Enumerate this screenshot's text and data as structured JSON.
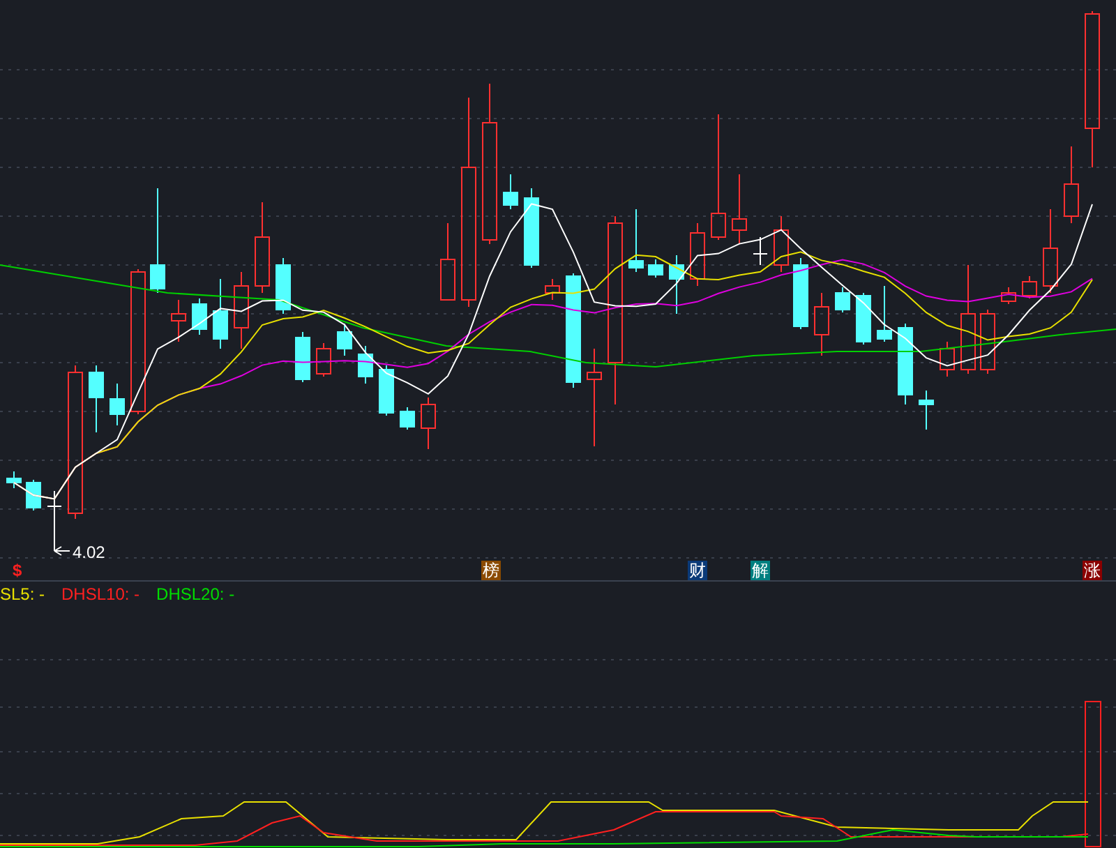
{
  "price_chart": {
    "low_label": "4.02"
  },
  "event_badges": [
    {
      "kind": "glyph",
      "label": "$",
      "color": "#ff2020"
    },
    {
      "kind": "tag",
      "label": "榜",
      "color": "#8b4a00"
    },
    {
      "kind": "tag",
      "label": "财",
      "color": "#0b3a78"
    },
    {
      "kind": "tag",
      "label": "解",
      "color": "#007f80"
    },
    {
      "kind": "tag",
      "label": "涨",
      "color": "#8b0000"
    }
  ],
  "indicator_legend": [
    {
      "label": "SL5: -",
      "color": "#e8e000"
    },
    {
      "label": "DHSL10: -",
      "color": "#ff2020"
    },
    {
      "label": "DHSL20: -",
      "color": "#00dd00"
    }
  ]
}
